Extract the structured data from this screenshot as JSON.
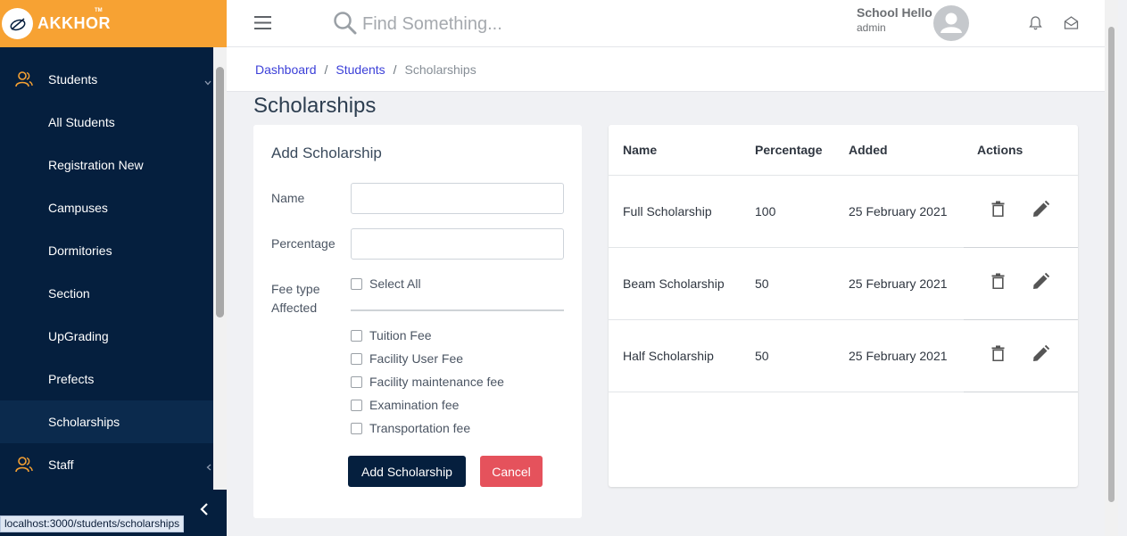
{
  "brand": {
    "name": "AKKHOR",
    "tm": "TM"
  },
  "sidebar": {
    "items": [
      {
        "label": "Students",
        "type": "parent"
      },
      {
        "label": "All Students",
        "type": "child"
      },
      {
        "label": "Registration New",
        "type": "child"
      },
      {
        "label": "Campuses",
        "type": "child"
      },
      {
        "label": "Dormitories",
        "type": "child"
      },
      {
        "label": "Section",
        "type": "child"
      },
      {
        "label": "UpGrading",
        "type": "child"
      },
      {
        "label": "Prefects",
        "type": "child"
      },
      {
        "label": "Scholarships",
        "type": "child",
        "active": true
      },
      {
        "label": "Staff",
        "type": "parent"
      }
    ]
  },
  "status_url": "localhost:3000/students/scholarships",
  "header": {
    "search_placeholder": "Find Something...",
    "user_name": "School Hello",
    "user_role": "admin"
  },
  "breadcrumb": {
    "items": [
      "Dashboard",
      "Students"
    ],
    "current": "Scholarships"
  },
  "page_title": "Scholarships",
  "form": {
    "title": "Add Scholarship",
    "name_label": "Name",
    "percentage_label": "Percentage",
    "fee_label_1": "Fee type",
    "fee_label_2": "Affected",
    "select_all": "Select All",
    "fees": [
      "Tuition Fee",
      "Facility User Fee",
      "Facility maintenance fee",
      "Examination fee",
      "Transportation fee"
    ],
    "add_button": "Add Scholarship",
    "cancel_button": "Cancel"
  },
  "table": {
    "columns": [
      "Name",
      "Percentage",
      "Added",
      "Actions"
    ],
    "rows": [
      {
        "name": "Full Scholarship",
        "percentage": "100",
        "added": "25 February 2021"
      },
      {
        "name": "Beam Scholarship",
        "percentage": "50",
        "added": "25 February 2021"
      },
      {
        "name": "Half Scholarship",
        "percentage": "50",
        "added": "25 February 2021"
      }
    ]
  },
  "colors": {
    "brand": "#f7a233",
    "sidebar": "#051f3e",
    "link": "#3b3fd8",
    "danger": "#e5525c"
  }
}
